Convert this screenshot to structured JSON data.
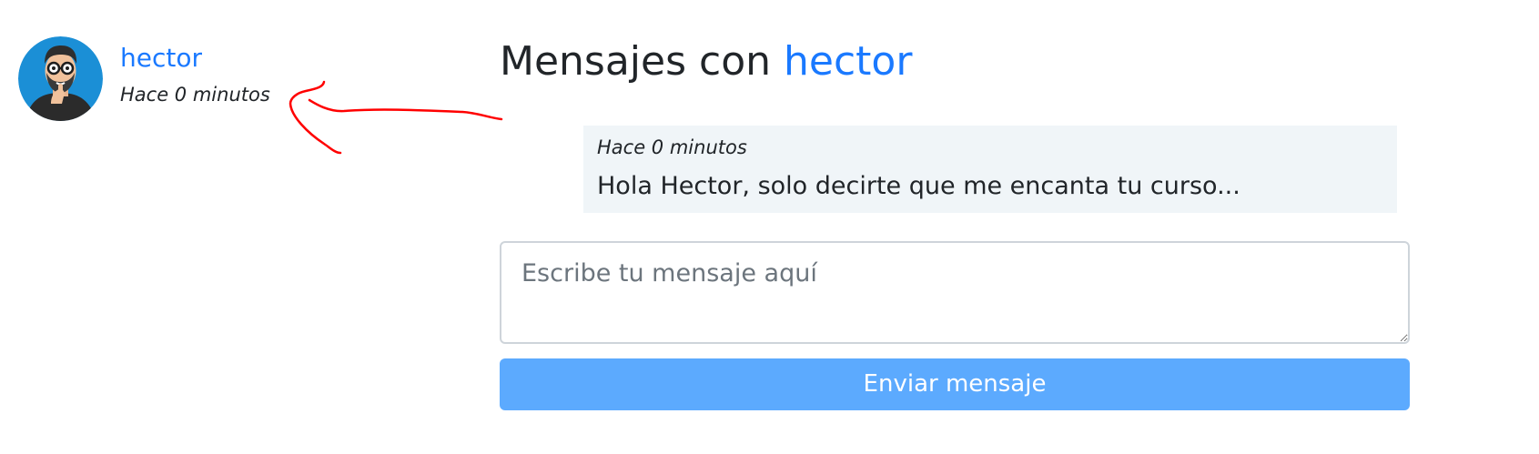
{
  "sidebar": {
    "thread": {
      "username": "hector",
      "time": "Hace 0 minutos",
      "avatar": "bearded-man-with-glasses-avatar"
    }
  },
  "chat": {
    "title_prefix": "Mensajes con",
    "title_user": "hector",
    "messages": [
      {
        "time": "Hace 0 minutos",
        "text": "Hola Hector, solo decirte que me encanta tu curso..."
      }
    ],
    "input": {
      "placeholder": "Escribe tu mensaje aquí",
      "value": ""
    },
    "send_label": "Enviar mensaje"
  },
  "annotation": {
    "icon": "red-hand-drawn-arrow",
    "color": "#ff0000"
  },
  "colors": {
    "link": "#1a79ff",
    "button": "#5caafe",
    "message_bg": "#f0f5f8"
  }
}
